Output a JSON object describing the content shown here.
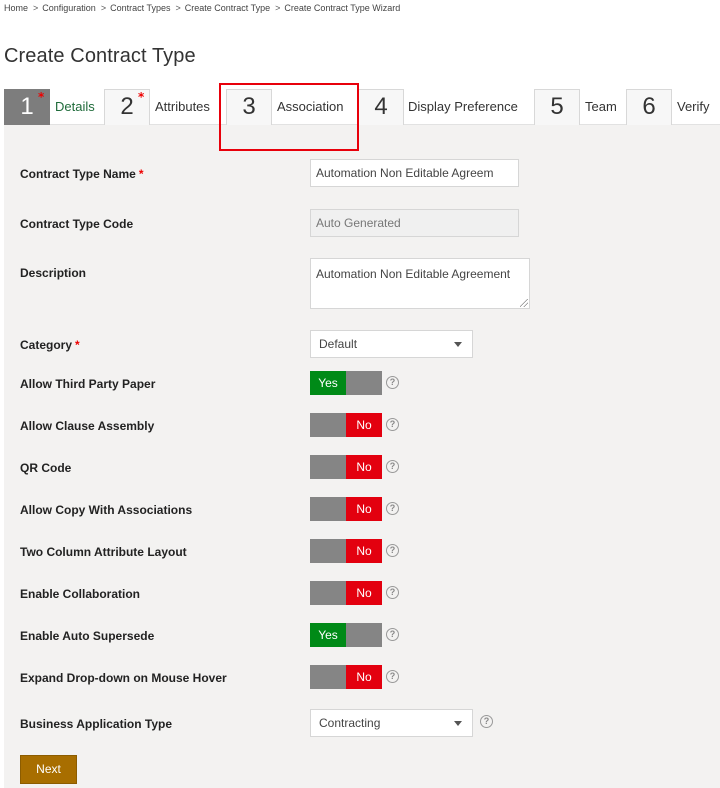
{
  "breadcrumb": [
    "Home",
    "Configuration",
    "Contract Types",
    "Create Contract Type",
    "Create Contract Type Wizard"
  ],
  "breadcrumb_separator": ">",
  "page_title": "Create Contract Type",
  "wizard": {
    "steps": [
      {
        "number": "1",
        "label": "Details",
        "required": "*",
        "active": true
      },
      {
        "number": "2",
        "label": "Attributes",
        "required": "*",
        "active": false
      },
      {
        "number": "3",
        "label": "Association",
        "required": "",
        "active": false,
        "highlighted": true
      },
      {
        "number": "4",
        "label": "Display Preference",
        "required": "",
        "active": false
      },
      {
        "number": "5",
        "label": "Team",
        "required": "",
        "active": false
      },
      {
        "number": "6",
        "label": "Verify",
        "required": "",
        "active": false
      }
    ]
  },
  "form": {
    "contract_type_name": {
      "label": "Contract Type Name",
      "required": "*",
      "value": "Automation Non Editable Agreem"
    },
    "contract_type_code": {
      "label": "Contract Type Code",
      "placeholder": "Auto Generated"
    },
    "description": {
      "label": "Description",
      "value": "Automation Non Editable Agreement"
    },
    "category": {
      "label": "Category",
      "required": "*",
      "value": "Default"
    },
    "toggles": [
      {
        "label": "Allow Third Party Paper",
        "state": "Yes",
        "help": "?"
      },
      {
        "label": "Allow Clause Assembly",
        "state": "No",
        "help": "?"
      },
      {
        "label": "QR Code",
        "state": "No",
        "help": "?"
      },
      {
        "label": "Allow Copy With Associations",
        "state": "No",
        "help": "?"
      },
      {
        "label": "Two Column Attribute Layout",
        "state": "No",
        "help": "?"
      },
      {
        "label": "Enable Collaboration",
        "state": "No",
        "help": "?"
      },
      {
        "label": "Enable Auto Supersede",
        "state": "Yes",
        "help": "?"
      },
      {
        "label": "Expand Drop-down on Mouse Hover",
        "state": "No",
        "help": "?"
      }
    ],
    "business_application_type": {
      "label": "Business Application Type",
      "value": "Contracting",
      "help": "?"
    }
  },
  "buttons": {
    "next": "Next"
  },
  "colors": {
    "yes": "#008a17",
    "no": "#e3000f",
    "toggle_off": "#858585",
    "active_step": "#7d7d7d",
    "next_button": "#a86e00",
    "highlight": "#e8000b"
  }
}
